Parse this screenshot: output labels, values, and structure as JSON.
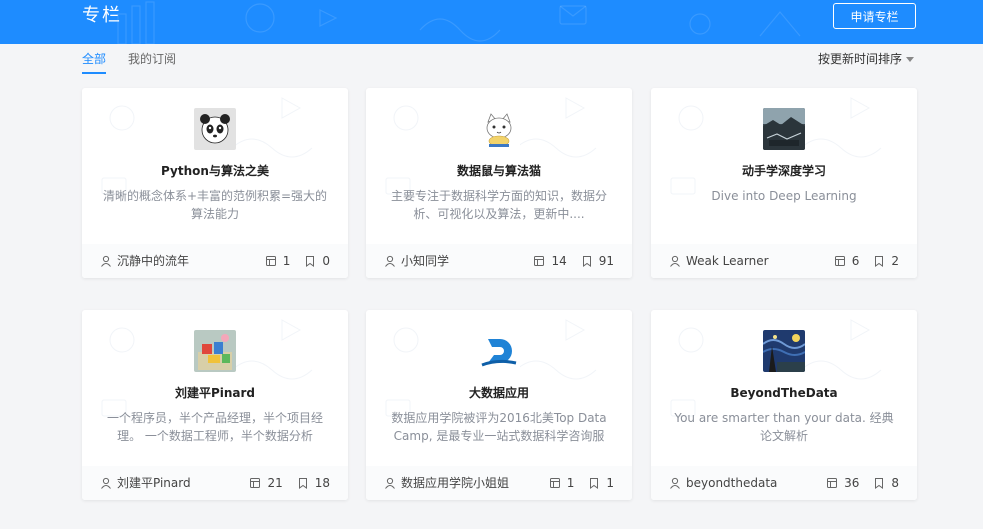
{
  "header": {
    "title": "专栏",
    "apply_label": "申请专栏"
  },
  "tabs": [
    {
      "label": "全部",
      "active": true
    },
    {
      "label": "我的订阅",
      "active": false
    }
  ],
  "sort": {
    "label": "按更新时间排序"
  },
  "colors": {
    "brand": "#1e8cff",
    "muted": "#8a8f99"
  },
  "cards": [
    {
      "title": "Python与算法之美",
      "desc": "清晰的概念体系+丰富的范例积累=强大的算法能力",
      "author": "沉静中的流年",
      "articles": "1",
      "subscribers": "0",
      "avatar": "panda-avatar-icon"
    },
    {
      "title": "数据鼠与算法猫",
      "desc": "主要专注于数据科学方面的知识，数据分析、可视化以及算法，更新中....",
      "author": "小知同学",
      "articles": "14",
      "subscribers": "91",
      "avatar": "cat-avatar-icon"
    },
    {
      "title": "动手学深度学习",
      "desc": "Dive into Deep Learning",
      "author": "Weak Learner",
      "articles": "6",
      "subscribers": "2",
      "avatar": "landscape-avatar-icon"
    },
    {
      "title": "刘建平Pinard",
      "desc": "一个程序员，半个产品经理，半个项目经理。 一个数据工程师，半个数据分析师。...",
      "author": "刘建平Pinard",
      "articles": "21",
      "subscribers": "18",
      "avatar": "toy-blocks-avatar-icon"
    },
    {
      "title": "大数据应用",
      "desc": "数据应用学院被评为2016北美Top Data Camp, 是最专业一站式数据科学咨询服务...",
      "author": "数据应用学院小姐姐",
      "articles": "1",
      "subscribers": "1",
      "avatar": "d-logo-avatar-icon"
    },
    {
      "title": "BeyondTheData",
      "desc": "You are smarter than your data. 经典论文解析",
      "author": "beyondthedata",
      "articles": "36",
      "subscribers": "8",
      "avatar": "starry-night-avatar-icon"
    }
  ]
}
